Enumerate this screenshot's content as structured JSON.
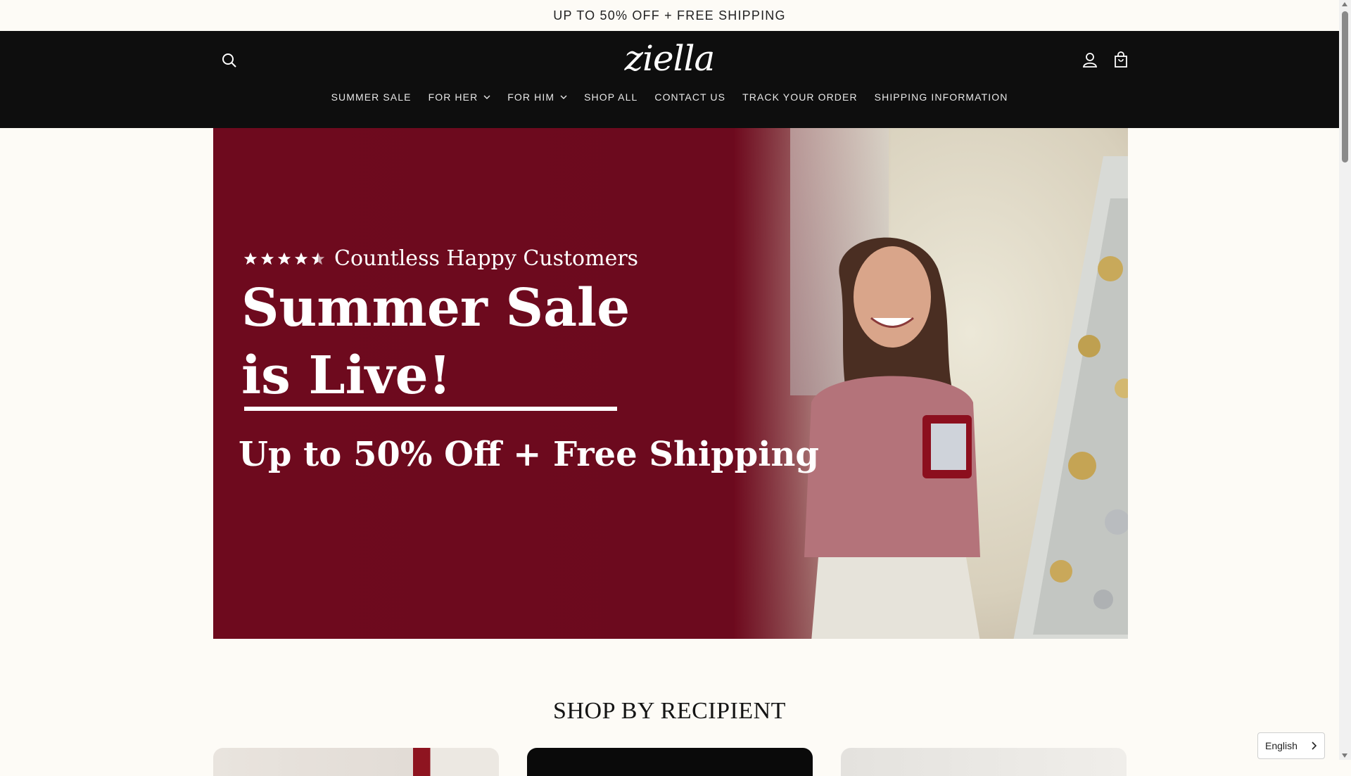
{
  "announcement": {
    "text": "UP TO 50% OFF + FREE SHIPPING"
  },
  "header": {
    "logo": "ziella",
    "icons": {
      "search": "search-icon",
      "account": "account-icon",
      "cart": "cart-icon"
    }
  },
  "nav": {
    "items": [
      {
        "label": "SUMMER SALE",
        "dropdown": false
      },
      {
        "label": "FOR HER",
        "dropdown": true
      },
      {
        "label": "FOR HIM",
        "dropdown": true
      },
      {
        "label": "SHOP ALL",
        "dropdown": false
      },
      {
        "label": "CONTACT US",
        "dropdown": false
      },
      {
        "label": "TRACK YOUR ORDER",
        "dropdown": false
      },
      {
        "label": "SHIPPING INFORMATION",
        "dropdown": false
      }
    ]
  },
  "hero": {
    "rating_stars": 4.5,
    "rating_text": "Countless Happy Customers",
    "headline_line1": "Summer Sale",
    "headline_line2": "is Live!",
    "subhead": "Up to 50% Off + Free Shipping",
    "background_color": "#6e0a1e"
  },
  "section": {
    "title": "SHOP BY RECIPIENT"
  },
  "language": {
    "selected": "English"
  }
}
